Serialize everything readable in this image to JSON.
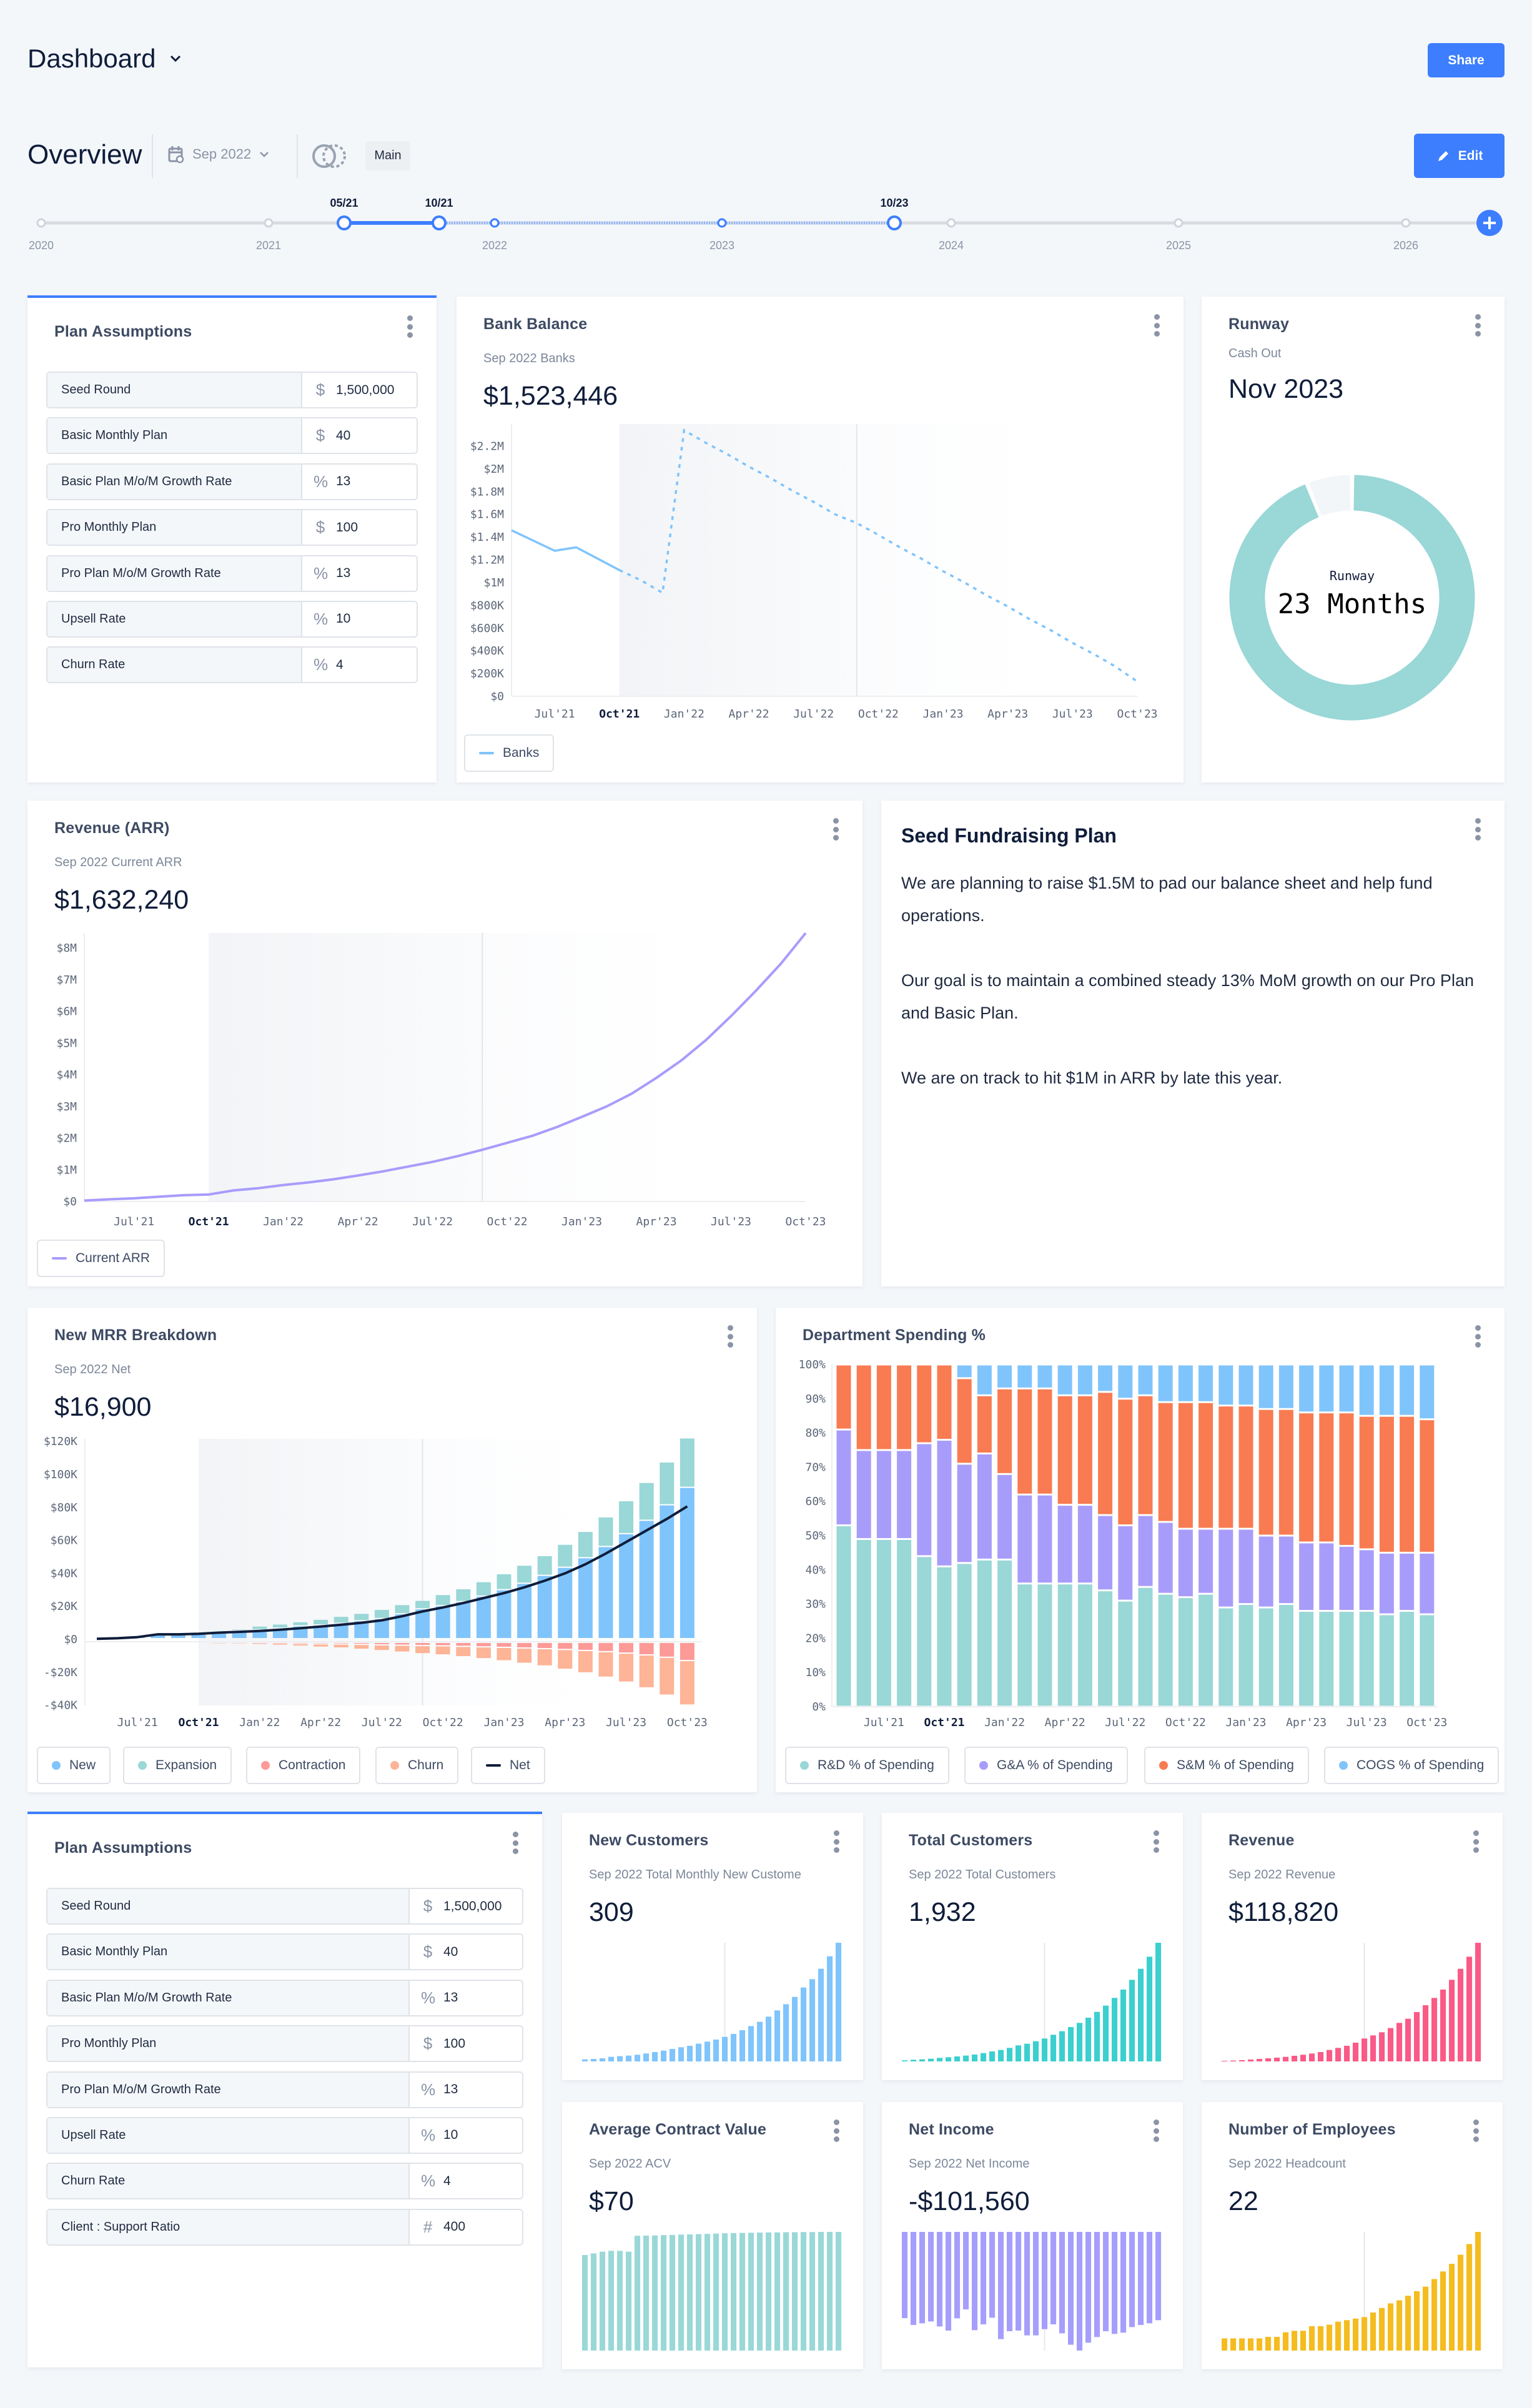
{
  "header": {
    "title": "Dashboard",
    "share_label": "Share"
  },
  "overview": {
    "title": "Overview",
    "date": "Sep 2022",
    "scenario": "Main",
    "edit_label": "Edit"
  },
  "timeline": {
    "years": [
      "2020",
      "2021",
      "2022",
      "2023",
      "2024",
      "2025",
      "2026"
    ],
    "markers": [
      "05/21",
      "10/21",
      "10/23"
    ]
  },
  "colors": {
    "accent": "#3d7eff",
    "teal": "#9ad7d7",
    "purple": "#a89cfb",
    "orange": "#f97b51",
    "light_blue": "#80c4fc",
    "contraction": "#fc9a98",
    "churn": "#fdb497",
    "net": "#0f1d3a"
  },
  "x_ticks": [
    "Jul'21",
    "Oct'21",
    "Jan'22",
    "Apr'22",
    "Jul'22",
    "Oct'22",
    "Jan'23",
    "Apr'23",
    "Jul'23",
    "Oct'23"
  ],
  "plan_assumptions": {
    "title": "Plan Assumptions",
    "rows": [
      {
        "label": "Seed Round",
        "unit": "$",
        "value": "1,500,000"
      },
      {
        "label": "Basic Monthly Plan",
        "unit": "$",
        "value": "40"
      },
      {
        "label": "Basic Plan M/o/M Growth Rate",
        "unit": "%",
        "value": "13"
      },
      {
        "label": "Pro Monthly Plan",
        "unit": "$",
        "value": "100"
      },
      {
        "label": "Pro Plan M/o/M Growth Rate",
        "unit": "%",
        "value": "13"
      },
      {
        "label": "Upsell Rate",
        "unit": "%",
        "value": "10"
      },
      {
        "label": "Churn Rate",
        "unit": "%",
        "value": "4"
      }
    ]
  },
  "plan_assumptions_2": {
    "title": "Plan Assumptions",
    "rows": [
      {
        "label": "Seed Round",
        "unit": "$",
        "value": "1,500,000"
      },
      {
        "label": "Basic Monthly Plan",
        "unit": "$",
        "value": "40"
      },
      {
        "label": "Basic Plan M/o/M Growth Rate",
        "unit": "%",
        "value": "13"
      },
      {
        "label": "Pro Monthly Plan",
        "unit": "$",
        "value": "100"
      },
      {
        "label": "Pro Plan M/o/M Growth Rate",
        "unit": "%",
        "value": "13"
      },
      {
        "label": "Upsell Rate",
        "unit": "%",
        "value": "10"
      },
      {
        "label": "Churn Rate",
        "unit": "%",
        "value": "4"
      },
      {
        "label": "Client : Support Ratio",
        "unit": "#",
        "value": "400"
      }
    ]
  },
  "bank": {
    "title": "Bank Balance",
    "subtitle": "Sep 2022 Banks",
    "value": "$1,523,446",
    "legend": "Banks",
    "chart": {
      "type": "line",
      "color": "#80c4fc",
      "actual_through": "Oct'21",
      "y_ticks": [
        "$0",
        "$200K",
        "$400K",
        "$600K",
        "$800K",
        "$1M",
        "$1.2M",
        "$1.4M",
        "$1.6M",
        "$1.8M",
        "$2M",
        "$2.2M"
      ],
      "ylim": [
        0,
        2340000
      ],
      "values": [
        1460000,
        1370000,
        1280000,
        1310000,
        1210000,
        1110000,
        1020000,
        910000,
        2340000,
        2230000,
        2130000,
        2020000,
        1920000,
        1810000,
        1710000,
        1600000,
        1523446,
        1420000,
        1310000,
        1210000,
        1100000,
        1000000,
        890000,
        790000,
        680000,
        580000,
        470000,
        370000,
        260000,
        130000
      ]
    }
  },
  "runway": {
    "title": "Runway",
    "subtitle": "Cash Out",
    "value": "Nov 2023",
    "center_label": "Runway",
    "center_value": "23 Months",
    "fill_fraction": 0.94,
    "color": "#9ad7d7"
  },
  "revenue_arr": {
    "title": "Revenue (ARR)",
    "subtitle": "Sep 2022 Current ARR",
    "value": "$1,632,240",
    "legend": "Current ARR",
    "chart": {
      "type": "line",
      "color": "#a89cfb",
      "y_ticks": [
        "$0",
        "$1M",
        "$2M",
        "$3M",
        "$4M",
        "$5M",
        "$6M",
        "$7M",
        "$8M"
      ],
      "ylim": [
        0,
        8500000
      ],
      "values": [
        30000,
        70000,
        100000,
        150000,
        200000,
        220000,
        350000,
        420000,
        520000,
        600000,
        700000,
        820000,
        950000,
        1100000,
        1250000,
        1430000,
        1632240,
        1850000,
        2070000,
        2350000,
        2670000,
        3000000,
        3400000,
        3900000,
        4450000,
        5100000,
        5850000,
        6650000,
        7500000,
        8470000
      ]
    }
  },
  "fundraising": {
    "title": "Seed Fundraising Plan",
    "paragraphs": [
      "We are planning to raise $1.5M to pad our balance sheet and help fund operations.",
      "Our goal is to maintain a combined steady 13% MoM growth on our Pro Plan and Basic Plan.",
      "We are on track to hit $1M in ARR by late this year."
    ]
  },
  "mrr": {
    "title": "New MRR Breakdown",
    "subtitle": "Sep 2022 Net",
    "value": "$16,900",
    "chart": {
      "type": "bar",
      "ylim": [
        -40000,
        120000
      ],
      "y_ticks": [
        "-$40K",
        "-$20K",
        "$0",
        "$20K",
        "$40K",
        "$60K",
        "$80K",
        "$100K",
        "$120K"
      ],
      "series": [
        {
          "name": "New",
          "color": "#80c4fc",
          "values": [
            0,
            0,
            1200,
            2500,
            3000,
            4000,
            4500,
            5000,
            5400,
            6400,
            7800,
            8300,
            9300,
            10900,
            12200,
            15100,
            18100,
            20000,
            22500,
            25800,
            29700,
            33600,
            38400,
            43300,
            49100,
            55900,
            63700,
            71800,
            81200,
            91800
          ]
        },
        {
          "name": "Expansion",
          "color": "#9ad7d7",
          "values": [
            0,
            0,
            0,
            0,
            0,
            0,
            500,
            1000,
            2300,
            2500,
            2500,
            3500,
            4300,
            4500,
            5600,
            5600,
            5200,
            6800,
            7800,
            8800,
            9700,
            11000,
            12000,
            14000,
            16000,
            18000,
            20000,
            23000,
            26000,
            30000
          ]
        },
        {
          "name": "Contraction",
          "color": "#fc9a98",
          "values": [
            0,
            0,
            0,
            0,
            0,
            0,
            0,
            0,
            -300,
            -500,
            -700,
            -900,
            -1000,
            -1200,
            -1500,
            -1700,
            -1900,
            -2100,
            -2400,
            -2700,
            -3000,
            -3400,
            -3800,
            -4300,
            -4900,
            -5600,
            -6500,
            -7600,
            -9000,
            -11000
          ]
        },
        {
          "name": "Churn",
          "color": "#fdb497",
          "values": [
            0,
            0,
            0,
            0,
            0,
            0,
            -500,
            -800,
            -1000,
            -1300,
            -1600,
            -2000,
            -2400,
            -3000,
            -3500,
            -4200,
            -5000,
            -5500,
            -6300,
            -7200,
            -8200,
            -9300,
            -10500,
            -12000,
            -13600,
            -15500,
            -17600,
            -20000,
            -23000,
            -27000
          ]
        },
        {
          "name": "Net",
          "color": "#0f1d3a",
          "values": [
            300,
            600,
            1300,
            3000,
            3000,
            3300,
            4000,
            4500,
            5000,
            5800,
            6700,
            7700,
            8800,
            10000,
            11500,
            14000,
            16900,
            19300,
            22000,
            25000,
            28000,
            31500,
            35500,
            40000,
            45500,
            52000,
            59000,
            66000,
            73000,
            80600
          ]
        }
      ]
    }
  },
  "dept": {
    "title": "Department Spending %",
    "chart": {
      "type": "bar",
      "stacked": true,
      "ylim": [
        0,
        100
      ],
      "y_ticks": [
        "0%",
        "10%",
        "20%",
        "30%",
        "40%",
        "50%",
        "60%",
        "70%",
        "80%",
        "90%",
        "100%"
      ],
      "series": [
        {
          "name": "R&D % of Spending",
          "color": "#9ad7d7",
          "values": [
            53,
            49,
            49,
            49,
            44,
            41,
            42,
            43,
            43,
            36,
            36,
            36,
            36,
            34,
            31,
            35,
            33,
            32,
            33,
            29,
            30,
            29,
            30,
            28,
            28,
            28,
            28,
            27,
            28,
            27
          ]
        },
        {
          "name": "G&A % of Spending",
          "color": "#a89cfb",
          "values": [
            28,
            26,
            26,
            26,
            33,
            37,
            29,
            31,
            25,
            26,
            26,
            23,
            23,
            22,
            22,
            21,
            21,
            20,
            19,
            23,
            22,
            21,
            20,
            20,
            20,
            19,
            18,
            18,
            17,
            18
          ]
        },
        {
          "name": "S&M % of Spending",
          "color": "#f97b51",
          "values": [
            19,
            25,
            25,
            25,
            23,
            22,
            25,
            17,
            25,
            31,
            31,
            32,
            32,
            36,
            37,
            35,
            35,
            37,
            37,
            36,
            36,
            37,
            37,
            38,
            38,
            39,
            39,
            40,
            40,
            39
          ]
        },
        {
          "name": "COGS % of Spending",
          "color": "#80c4fc",
          "values": [
            0,
            0,
            0,
            0,
            0,
            0,
            4,
            9,
            7,
            7,
            7,
            9,
            9,
            8,
            10,
            9,
            11,
            11,
            11,
            12,
            12,
            13,
            13,
            14,
            14,
            14,
            15,
            15,
            15,
            16
          ]
        }
      ]
    }
  },
  "small_cards": [
    {
      "title": "New Customers",
      "subtitle": "Sep 2022 Total Monthly New Custome",
      "value": "309",
      "color": "#80c4fc",
      "values": [
        26,
        31,
        39,
        58,
        66,
        73,
        84,
        100,
        118,
        136,
        157,
        178,
        197,
        223,
        249,
        275,
        309,
        346,
        393,
        445,
        498,
        563,
        642,
        720,
        812,
        930,
        1035,
        1166,
        1323,
        1493
      ]
    },
    {
      "title": "Total Customers",
      "subtitle": "Sep 2022 Total Customers",
      "value": "1,932",
      "color": "#3ccfcf",
      "values": [
        88,
        140,
        176,
        228,
        299,
        351,
        421,
        492,
        579,
        702,
        843,
        966,
        1141,
        1352,
        1493,
        1703,
        1932,
        2248,
        2546,
        2897,
        3249,
        3688,
        4179,
        4706,
        5356,
        6058,
        6883,
        7814,
        8832,
        10009
      ]
    },
    {
      "title": "Revenue",
      "subtitle": "Sep 2022 Revenue",
      "value": "$118,820",
      "color": "#fa5a86",
      "values": [
        3240,
        4320,
        6480,
        9720,
        12960,
        16200,
        19440,
        23760,
        29160,
        34560,
        41040,
        48600,
        59400,
        70200,
        81000,
        97200,
        118820,
        135000,
        151200,
        172800,
        199800,
        221400,
        255960,
        291600,
        329400,
        372600,
        423360,
        480600,
        543240,
        615600
      ]
    },
    {
      "title": "Average Contract Value",
      "subtitle": "Sep 2022 ACV",
      "value": "$70",
      "color": "#9ad8d8",
      "values": [
        57,
        58,
        59,
        59.5,
        59.5,
        59,
        68.5,
        68.6,
        68.7,
        68.9,
        69,
        69.2,
        69.3,
        69.5,
        69.6,
        69.8,
        70,
        70.1,
        70.2,
        70.3,
        70.4,
        70.5,
        70.5,
        70.6,
        70.6,
        70.7,
        70.7,
        70.8,
        70.8,
        70.8
      ]
    },
    {
      "title": "Net Income",
      "subtitle": "Sep 2022 Net Income",
      "value": "-$101,560",
      "color": "#a69efc",
      "values": [
        -90060,
        -97220,
        -95480,
        -93530,
        -98740,
        -103080,
        -90270,
        -80940,
        -102640,
        -96570,
        -89620,
        -111970,
        -103730,
        -103080,
        -108070,
        -108070,
        -101560,
        -96570,
        -105900,
        -117830,
        -123910,
        -115660,
        -109800,
        -103730,
        -106550,
        -105250,
        -99390,
        -97220,
        -95480,
        -92230
      ]
    },
    {
      "title": "Number of Employees",
      "subtitle": "Sep 2022 Headcount",
      "value": "22",
      "color": "#f5bc1f",
      "values": [
        8,
        8,
        8,
        8,
        8,
        9,
        9,
        12,
        13,
        13,
        16,
        16,
        17,
        19,
        20,
        21,
        22,
        25,
        28,
        31,
        33,
        36,
        39,
        42,
        47,
        52,
        57,
        63,
        70,
        78
      ]
    }
  ]
}
